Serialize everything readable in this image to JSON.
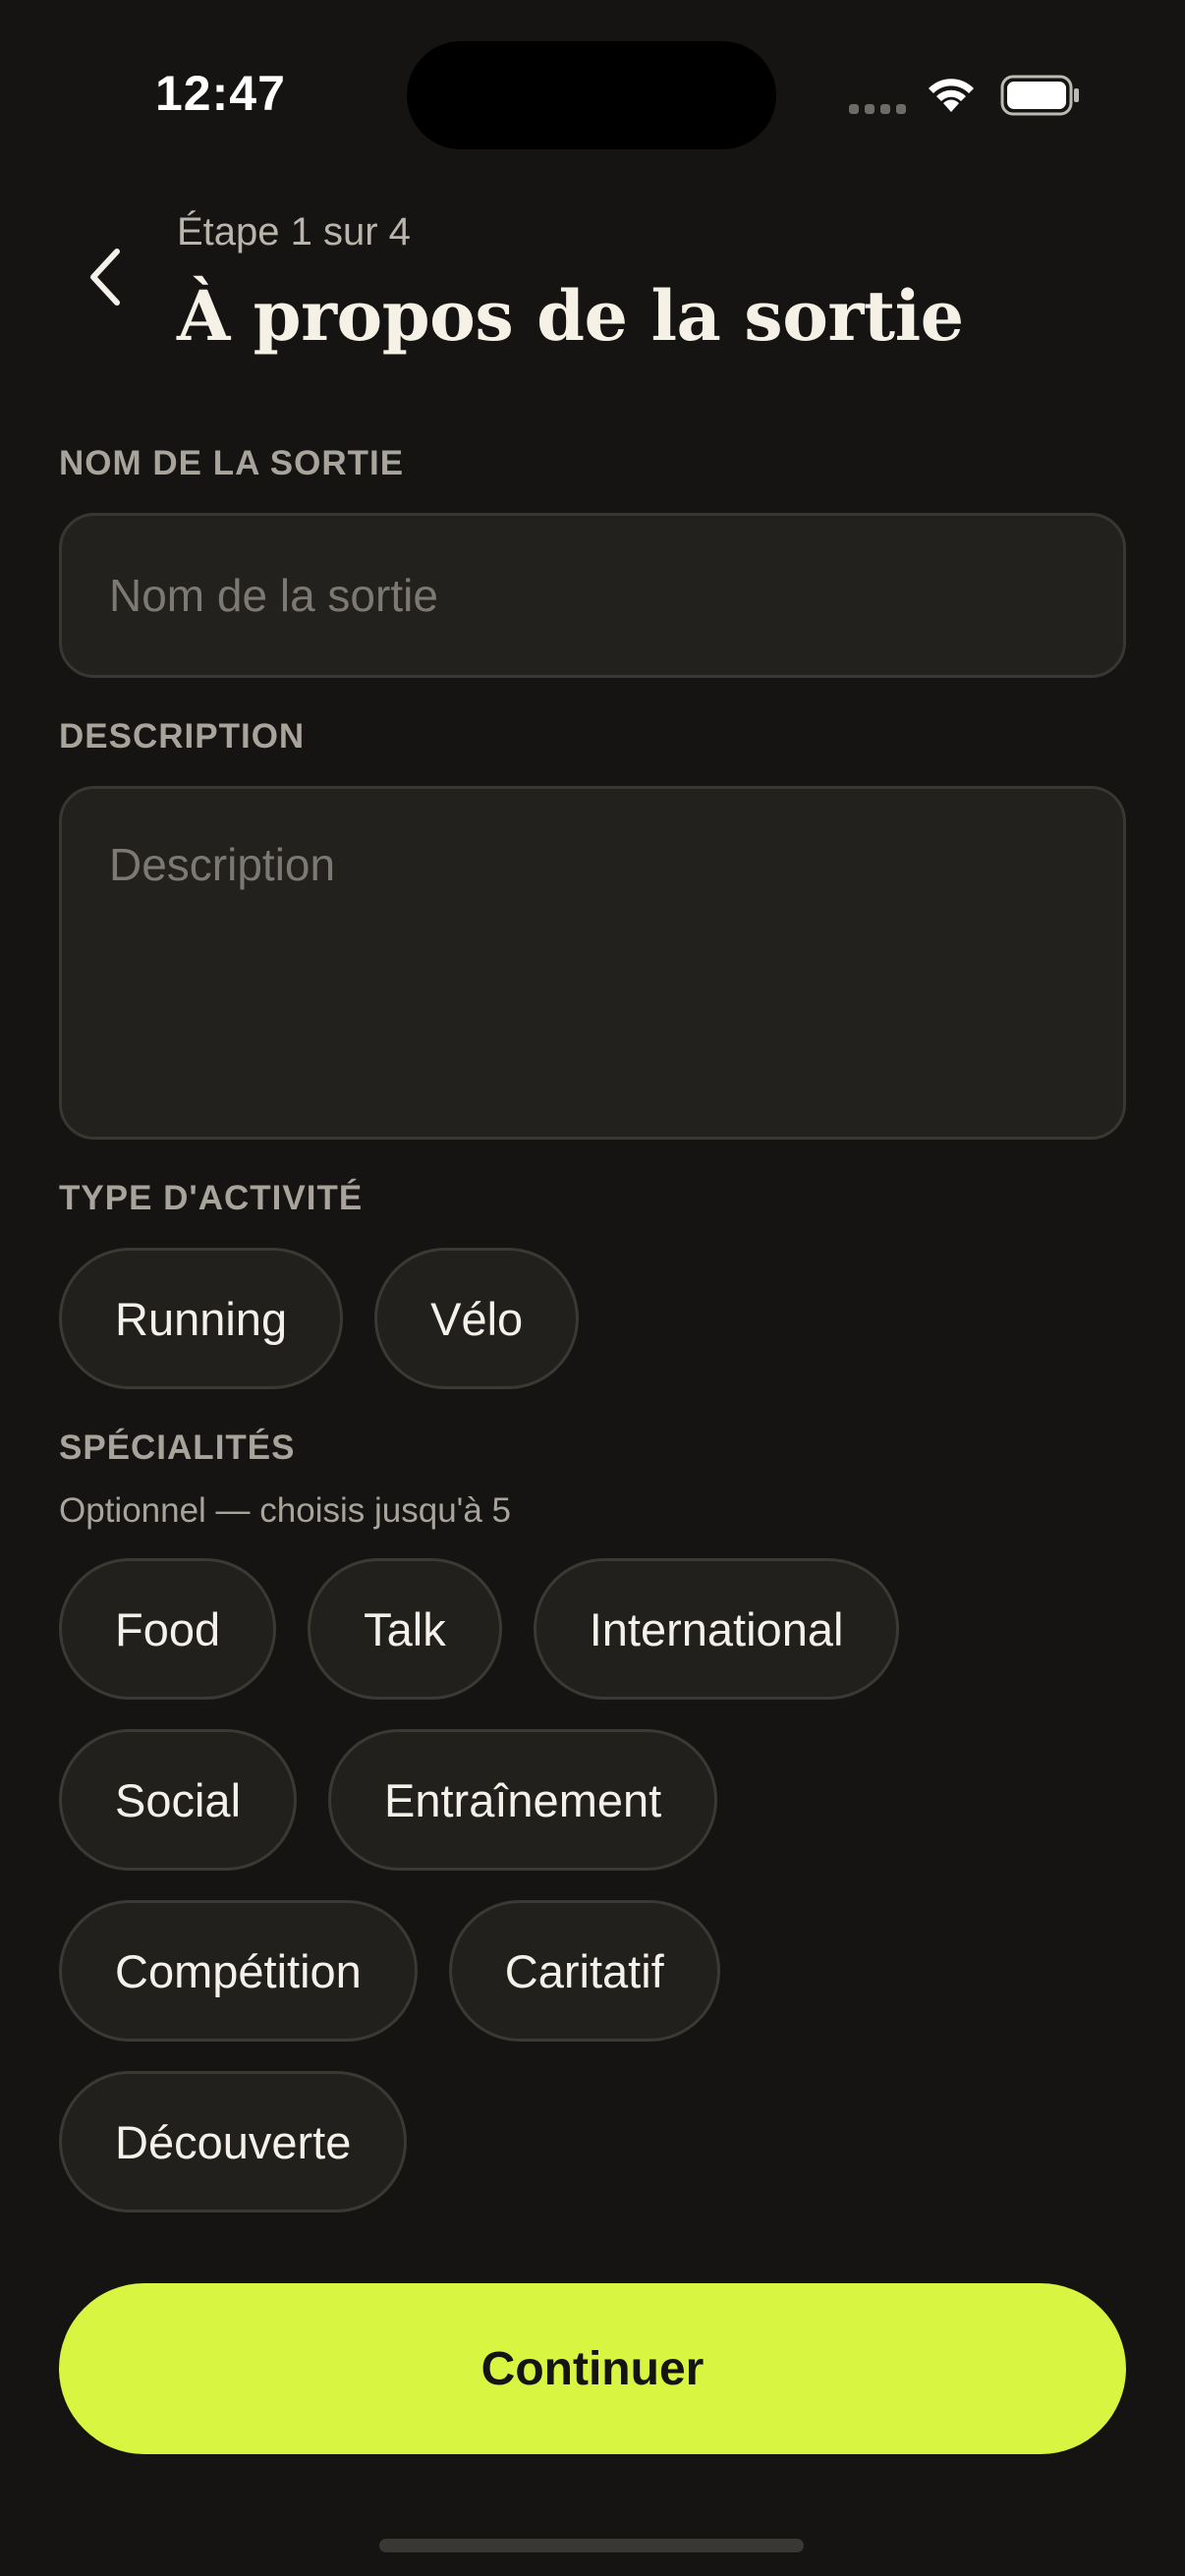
{
  "status_bar": {
    "time": "12:47",
    "icons": [
      "signal-icon",
      "wifi-icon",
      "battery-icon"
    ]
  },
  "header": {
    "back_icon": "chevron-left-icon",
    "step": "Étape 1 sur 4",
    "title": "À propos de la sortie"
  },
  "name_section": {
    "label": "NOM DE LA SORTIE",
    "value": "",
    "placeholder": "Nom de la sortie"
  },
  "description_section": {
    "label": "DESCRIPTION",
    "value": "",
    "placeholder": "Description"
  },
  "activity_section": {
    "label": "TYPE D'ACTIVITÉ",
    "options": [
      "Running",
      "Vélo"
    ]
  },
  "specialties_section": {
    "label": "SPÉCIALITÉS",
    "hint": "Optionnel — choisis jusqu'à 5",
    "options": [
      "Food",
      "Talk",
      "International",
      "Social",
      "Entraînement",
      "Compétition",
      "Caritatif",
      "Découverte"
    ]
  },
  "continue_label": "Continuer",
  "colors": {
    "background": "#151412",
    "accent": "#d8f542",
    "chip_bg": "#22201d",
    "field_bg": "#23211e"
  }
}
